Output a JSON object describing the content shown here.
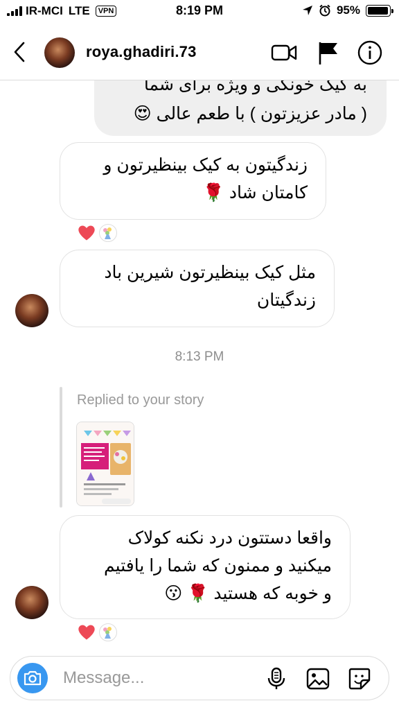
{
  "status_bar": {
    "carrier": "IR-MCI",
    "network": "LTE",
    "vpn": "VPN",
    "time": "8:19 PM",
    "battery_text": "95%",
    "battery_level": 0.95
  },
  "header": {
    "username": "roya.ghadiri.73",
    "icons": [
      "back-chevron",
      "video-camera",
      "flag",
      "info"
    ]
  },
  "messages": [
    {
      "from": "me",
      "lines": [
        "به کیک خونگی و ویژه برای شما",
        "( مادر عزیزتون ) با طعم عالی 😍"
      ]
    },
    {
      "from": "them",
      "lines": [
        "زندگیتون به کیک بینظیرتون و",
        "کامتان شاد 🌹"
      ],
      "reactions": [
        "❤️",
        "💐"
      ]
    },
    {
      "from": "them",
      "lines": [
        "مثل کیک بینظیرتون شیرین باد",
        "زندگیتان"
      ]
    },
    {
      "from": "them",
      "lines": [
        "واقعا دستتون درد نکنه کولاک",
        "میکنید و ممنون که شما را یافتیم",
        "و خوبه که هستید 🌹 😗"
      ],
      "reactions": [
        "❤️",
        "💐"
      ]
    }
  ],
  "timestamp": "8:13 PM",
  "reply": {
    "label": "Replied to your story"
  },
  "composer": {
    "placeholder": "Message...",
    "icons": [
      "camera",
      "microphone",
      "gallery",
      "sticker"
    ]
  },
  "colors": {
    "accent": "#3897f0",
    "heart": "#ed4956",
    "bubble_mine": "#efefef",
    "border": "#dbdbdb",
    "muted": "#8e8e8e"
  }
}
